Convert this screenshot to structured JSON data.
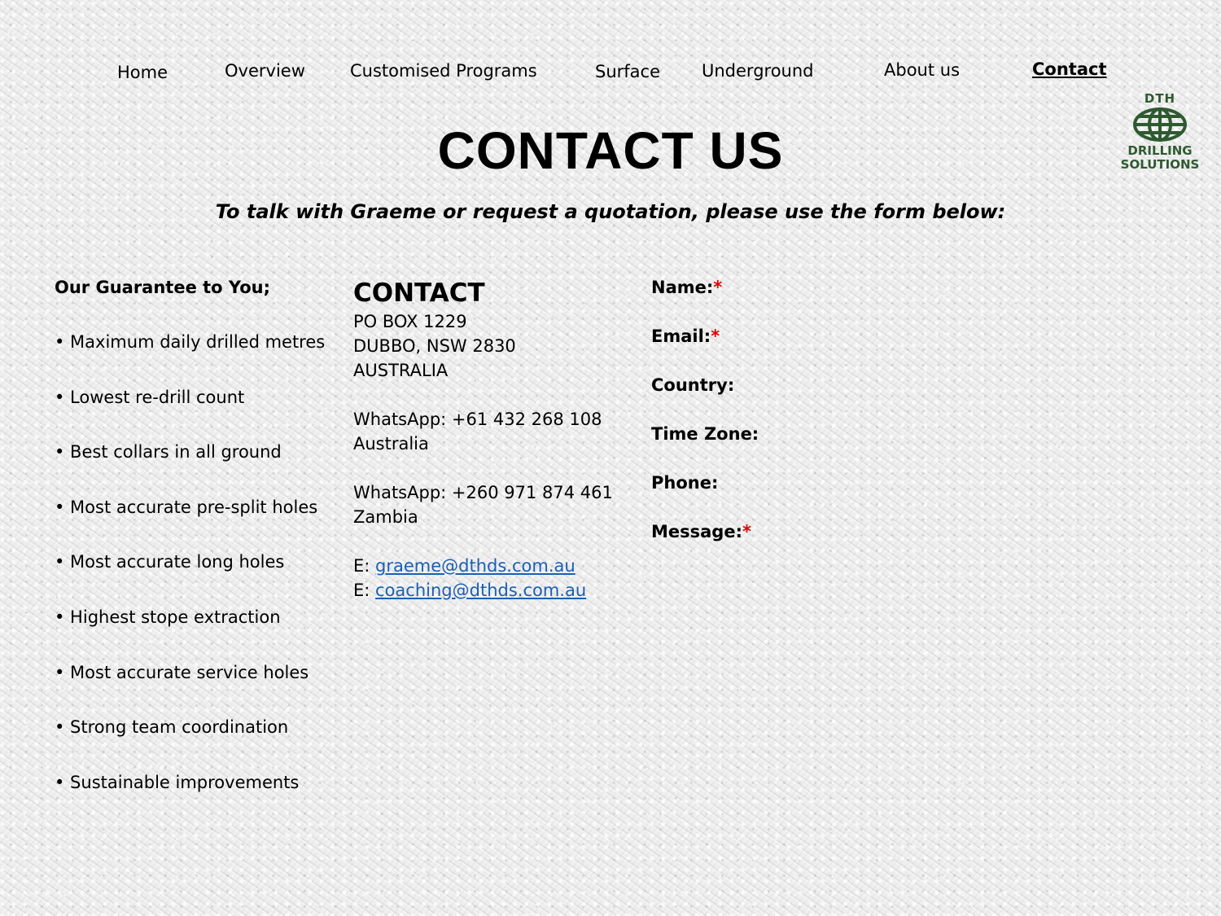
{
  "nav": {
    "home": "Home",
    "overview": "Overview",
    "customised": "Customised Programs",
    "surface": "Surface",
    "underground": "Underground",
    "about": "About us",
    "contact": "Contact"
  },
  "logo": {
    "line1": "DTH",
    "line2": "DRILLING",
    "line3": "SOLUTIONS",
    "icon": "globe-icon",
    "color": "#2f5a31"
  },
  "page": {
    "title": "CONTACT US",
    "subtitle": "To talk with Graeme or request a quotation, please use the form below:"
  },
  "guarantee": {
    "heading": "Our Guarantee to You;",
    "items": [
      "• Maximum daily drilled metres",
      "• Lowest re-drill count",
      "• Best collars in all ground",
      "• Most accurate pre-split holes",
      "• Most accurate long holes",
      "• Highest stope extraction",
      "• Most accurate service holes",
      "• Strong team coordination",
      "• Sustainable improvements"
    ]
  },
  "contact": {
    "heading": "CONTACT",
    "address1": "PO BOX 1229",
    "address2": "DUBBO, NSW 2830",
    "address3": "AUSTRALIA",
    "whatsapp1": "WhatsApp: +61 432 268 108",
    "whatsapp1_country": "Australia",
    "whatsapp2": "WhatsApp: +260 971 874 461",
    "whatsapp2_country": "Zambia",
    "email_prefix": "E: ",
    "email1": "graeme@dthds.com.au",
    "email2": "coaching@dthds.com.au",
    "link_color": "#1a5fb4"
  },
  "form": {
    "name": "Name:",
    "email": "Email:",
    "country": "Country:",
    "timezone": "Time Zone:",
    "phone": "Phone:",
    "message": "Message:",
    "required_mark": "*",
    "required_color": "#e00000"
  }
}
